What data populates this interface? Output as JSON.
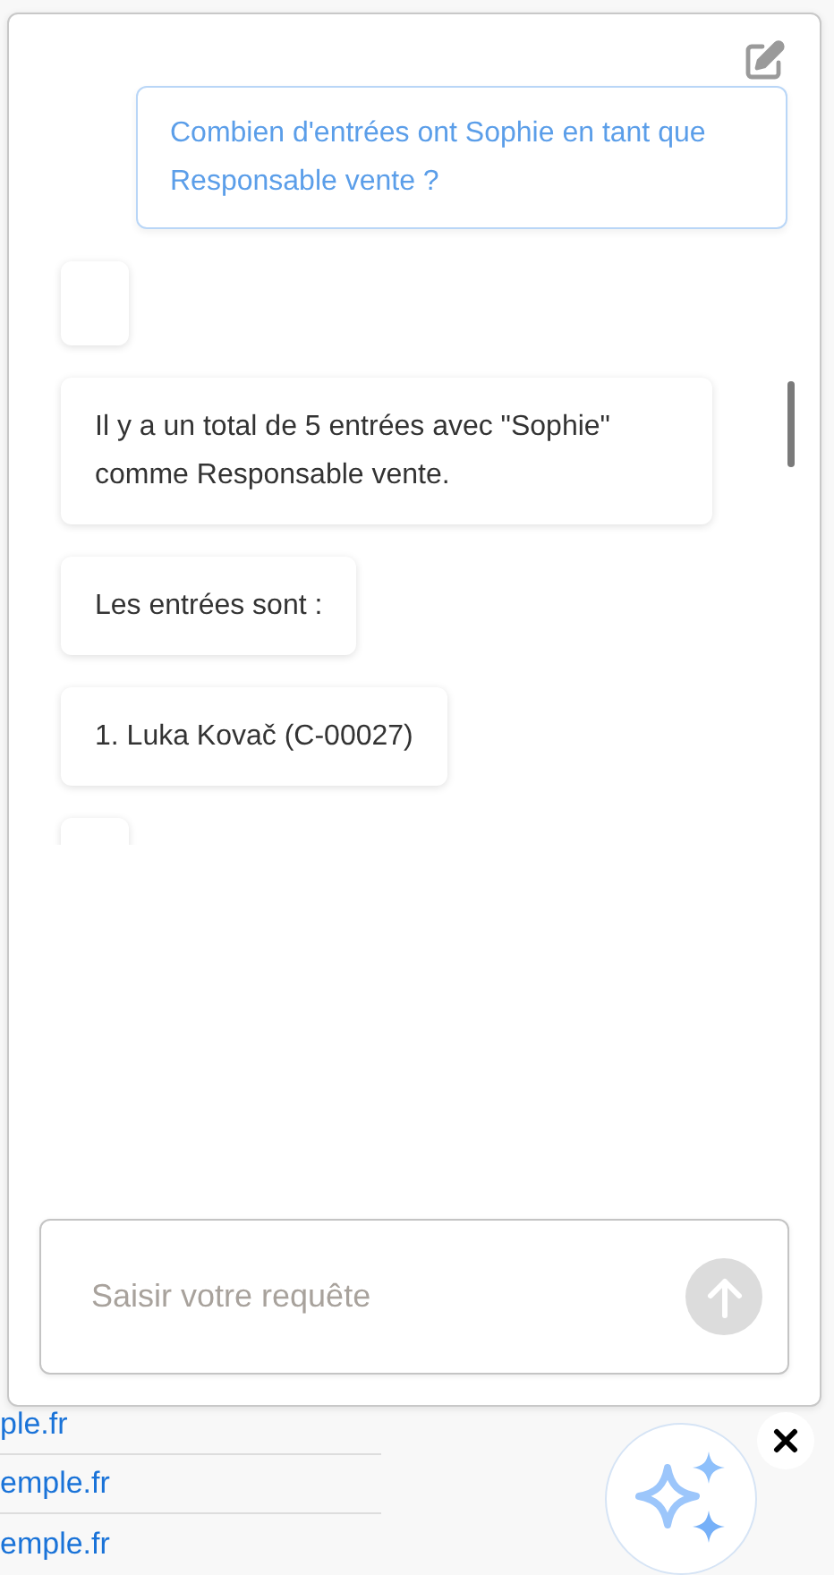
{
  "background_links": [
    "ple.fr",
    "emple.fr",
    "emple.fr"
  ],
  "chat": {
    "messages": [
      {
        "kind": "user",
        "text": "Combien d'entrées ont Sophie en tant que Responsable vente ?"
      },
      {
        "kind": "empty"
      },
      {
        "kind": "bot",
        "text": "Il y a un total de 5 entrées avec \"Sophie\" comme Responsable vente."
      },
      {
        "kind": "bot",
        "text": "Les entrées sont :"
      },
      {
        "kind": "bot",
        "text": "1. Luka Kovač (C-00027)"
      },
      {
        "kind": "empty"
      }
    ],
    "input": {
      "placeholder": "Saisir votre requête"
    }
  }
}
